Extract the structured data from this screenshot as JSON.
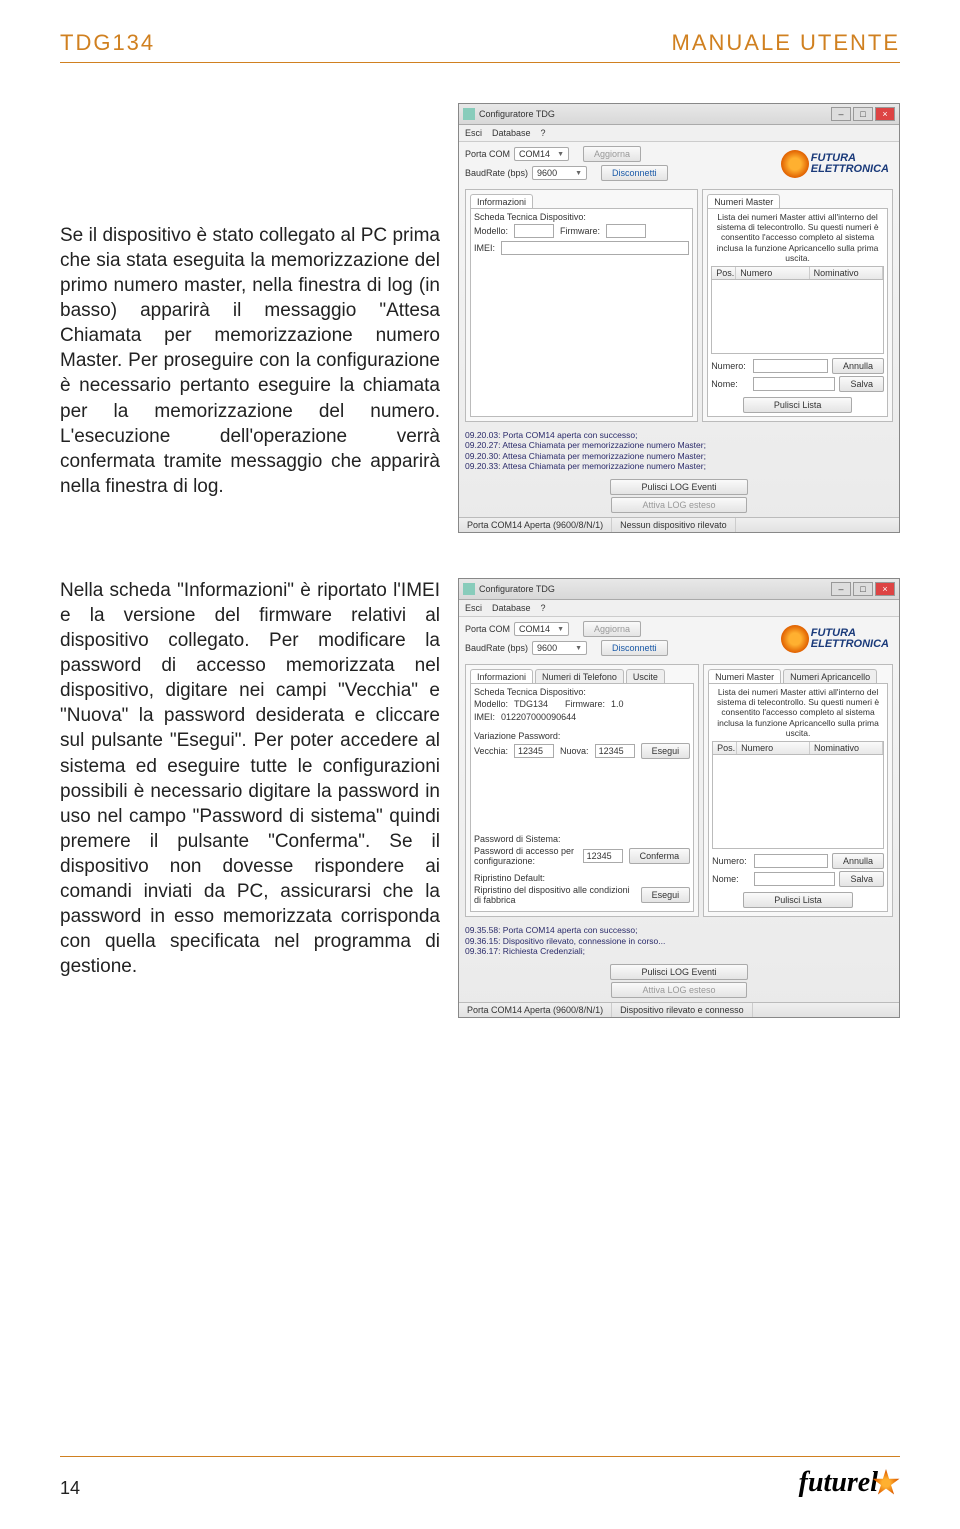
{
  "header": {
    "left": "TDG134",
    "right": "MANUALE UTENTE"
  },
  "para1": "Se il dispositivo è stato collegato al PC prima che sia stata eseguita la memorizzazione del primo numero master, nella finestra di log (in basso) apparirà il messaggio \"Attesa Chiamata per memorizzazione numero Master. Per proseguire con la configurazione è necessario pertanto eseguire la chiamata per la memorizzazione del numero. L'esecuzione dell'operazione verrà confermata tramite messaggio che apparirà nella finestra di log.",
  "para2": "Nella scheda \"Informazioni\" è riportato l'IMEI e la versione del firmware relativi al dispositivo collegato. Per modificare la password di accesso memorizzata nel dispositivo, digitare nei campi \"Vecchia\" e \"Nuova\" la password desiderata e cliccare sul pulsante \"Esegui\". Per poter accedere al sistema ed eseguire tutte le configurazioni possibili è necessario digitare la password in uso nel campo \"Password di sistema\" quindi premere il pulsante \"Conferma\". Se il dispositivo non dovesse rispondere ai comandi inviati da PC, assicurarsi che la password in esso memorizzata corrisponda con quella specificata nel programma di gestione.",
  "app": {
    "title": "Configuratore TDG",
    "menu": {
      "esci": "Esci",
      "database": "Database",
      "help": "?"
    },
    "porta_label": "Porta COM",
    "porta_value": "COM14",
    "baud_label": "BaudRate (bps)",
    "baud_value": "9600",
    "aggiorna": "Aggiorna",
    "disconnetti": "Disconnetti",
    "logo_line1": "FUTURA",
    "logo_line2": "ELETTRONICA",
    "tabs": {
      "informazioni": "Informazioni",
      "numeri_tel": "Numeri di Telefono",
      "uscite": "Uscite",
      "numeri_master": "Numeri Master",
      "numeri_apri": "Numeri Apricancello"
    },
    "scheda_title": "Scheda Tecnica Dispositivo:",
    "modello_label": "Modello:",
    "firmware_label": "Firmware:",
    "imei_label": "IMEI:",
    "master_desc1": "Lista dei numeri Master attivi all'interno del sistema di telecontrollo. Su questi numeri è consentito l'accesso completo al sistema inclusa la funzione Apricancello sulla prima uscita.",
    "table": {
      "pos": "Pos.",
      "numero": "Numero",
      "nominativo": "Nominativo"
    },
    "numero_label": "Numero:",
    "nome_label": "Nome:",
    "annulla": "Annulla",
    "salva": "Salva",
    "pulisci_lista": "Pulisci Lista",
    "pulisci_log": "Pulisci LOG Eventi",
    "attiva_log": "Attiva LOG esteso",
    "status_porta": "Porta COM14 Aperta (9600/8/N/1)",
    "status_nessun": "Nessun dispositivo rilevato",
    "status_connesso": "Dispositivo rilevato e connesso"
  },
  "shot1_log": [
    "09.20.03: Porta COM14 aperta con successo;",
    "09.20.27: Attesa Chiamata per memorizzazione numero Master;",
    "09.20.30: Attesa Chiamata per memorizzazione numero Master;",
    "09.20.33: Attesa Chiamata per memorizzazione numero Master;"
  ],
  "shot2": {
    "modello_value": "TDG134",
    "firmware_value": "1.0",
    "imei_value": "012207000090644",
    "var_pwd_title": "Variazione Password:",
    "vecchia_label": "Vecchia:",
    "vecchia_value": "12345",
    "nuova_label": "Nuova:",
    "nuova_value": "12345",
    "esegui": "Esegui",
    "pwd_sistema_title": "Password di Sistema:",
    "pwd_accesso_label": "Password di accesso per configurazione:",
    "pwd_accesso_value": "12345",
    "conferma": "Conferma",
    "ripristino_title": "Ripristino Default:",
    "ripristino_label": "Ripristino del dispositivo alle condizioni di fabbrica",
    "master_desc2": "Lista dei numeri Master attivi all'interno del sistema di telecontrollo. Su questi numeri è consentito l'accesso completo al sistema inclusa la funzione Apricancello sulla prima uscita.",
    "log": [
      "09.35.58: Porta COM14 aperta con successo;",
      "09.36.15: Dispositivo rilevato, connessione in corso...",
      "09.36.17: Richiesta Credenziali;"
    ]
  },
  "footer": {
    "page": "14",
    "brand": "futurel"
  }
}
